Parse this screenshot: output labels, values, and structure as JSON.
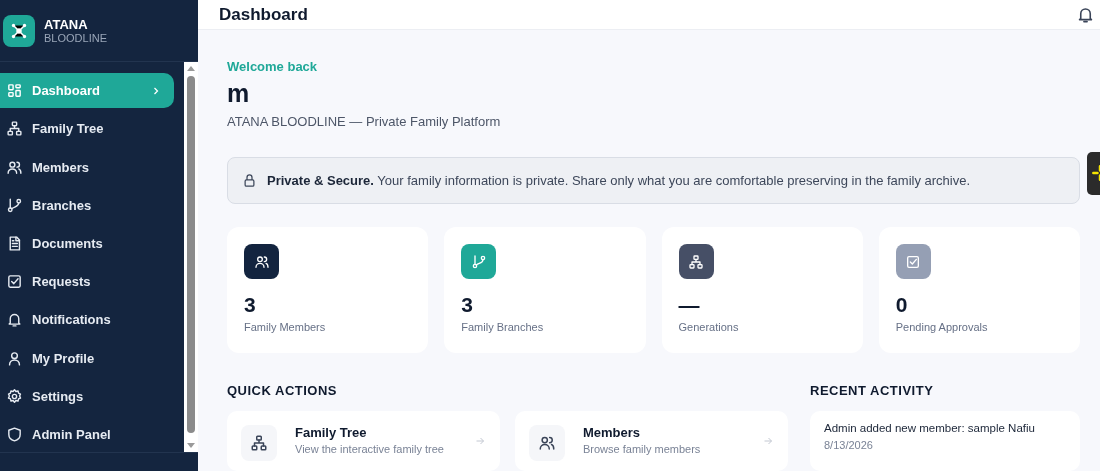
{
  "brand": {
    "name": "ATANA",
    "subtitle": "BLOODLINE"
  },
  "sidebar": {
    "items": [
      {
        "label": "Dashboard",
        "selected": true
      },
      {
        "label": "Family Tree",
        "selected": false
      },
      {
        "label": "Members",
        "selected": false
      },
      {
        "label": "Branches",
        "selected": false
      },
      {
        "label": "Documents",
        "selected": false
      },
      {
        "label": "Requests",
        "selected": false
      },
      {
        "label": "Notifications",
        "selected": false
      },
      {
        "label": "My Profile",
        "selected": false
      },
      {
        "label": "Settings",
        "selected": false
      },
      {
        "label": "Admin Panel",
        "selected": false
      }
    ]
  },
  "header": {
    "title": "Dashboard"
  },
  "welcome": {
    "greeting": "Welcome back",
    "name": "m",
    "tagline": "ATANA BLOODLINE — Private Family Platform"
  },
  "notice": {
    "text": "**Private & Secure.** Your family information is private. Share only what you are comfortable preserving in the family archive."
  },
  "stats": [
    {
      "value": "3",
      "label": "Family Members",
      "color": "#13243f"
    },
    {
      "value": "3",
      "label": "Family Branches",
      "color": "#1fa898"
    },
    {
      "value": "—",
      "label": "Generations",
      "color": "#464f66"
    },
    {
      "value": "0",
      "label": "Pending Approvals",
      "color": "#959fb4"
    }
  ],
  "quick_actions": {
    "title": "QUICK ACTIONS",
    "items": [
      {
        "title": "Family Tree",
        "description": "View the interactive family tree"
      },
      {
        "title": "Members",
        "description": "Browse family members"
      }
    ]
  },
  "recent_activity": {
    "title": "RECENT ACTIVITY",
    "items": [
      {
        "text": "Admin added new member: sample Nafiu",
        "date": "8/13/2026"
      }
    ]
  }
}
